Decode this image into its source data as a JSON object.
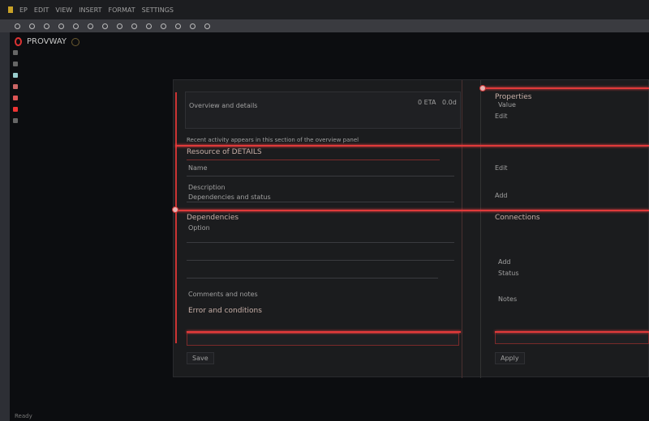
{
  "titlebar": {
    "menu": [
      "EP",
      "EDIT",
      "VIEW",
      "INSERT",
      "FORMAT",
      "SETTINGS"
    ]
  },
  "app": {
    "title": "PROVWAY"
  },
  "panel": {
    "card_title": "Overview and details",
    "card_meta": [
      "0 ETA",
      "0.0d"
    ],
    "description": "Recent activity appears in this section of the overview panel",
    "section1": {
      "title": "Resource of DETAILS",
      "rows": [
        "Name",
        "Description",
        "Dependencies and status"
      ]
    },
    "section2": {
      "title": "Dependencies",
      "rows": [
        "Option"
      ],
      "footer": "Comments and notes"
    },
    "section3": {
      "title": "Error and conditions",
      "rows": []
    },
    "save_label": "Save",
    "right": {
      "title": "Properties",
      "sub": "Value",
      "rows": [
        "Edit",
        "Edit",
        "Add",
        "Connections",
        "Add",
        "Status",
        "Notes"
      ],
      "button": "Apply"
    }
  },
  "status": {
    "text": "Ready"
  },
  "colors": {
    "accent": "#e03a3a",
    "background": "#0c0d10",
    "panel": "#1b1c1e"
  }
}
